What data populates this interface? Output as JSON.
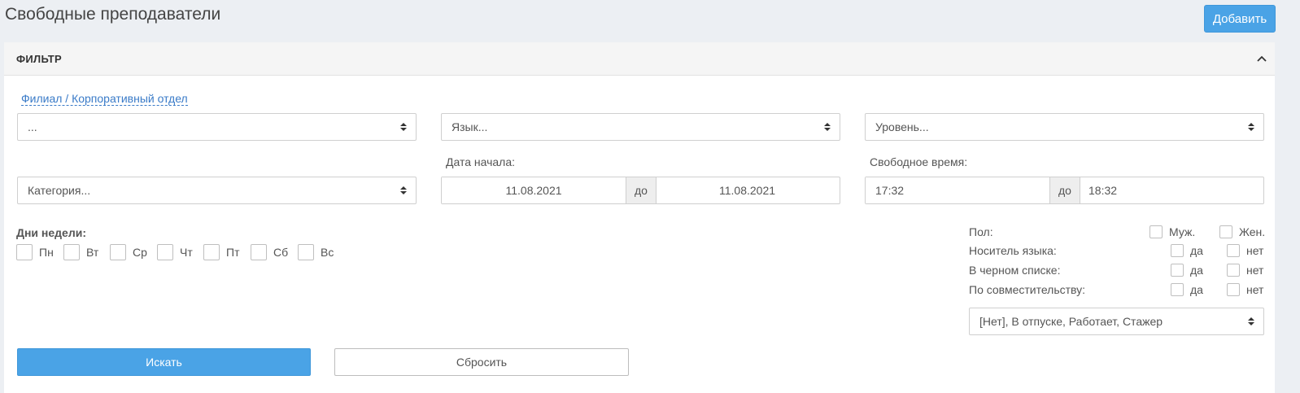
{
  "page": {
    "title": "Свободные преподаватели",
    "add_button": "Добавить"
  },
  "filter": {
    "title": "ФИЛЬТР",
    "branch_link": "Филиал / Корпоративный отдел",
    "branch_select": "...",
    "language_select": "Язык...",
    "level_select": "Уровень...",
    "category_select": "Категория...",
    "start_date": {
      "label": "Дата начала:",
      "from": "11.08.2021",
      "separator": "до",
      "to": "11.08.2021"
    },
    "free_time": {
      "label": "Свободное время:",
      "from": "17:32",
      "separator": "до",
      "to": "18:32"
    },
    "weekdays": {
      "label": "Дни недели:",
      "days": [
        "Пн",
        "Вт",
        "Ср",
        "Чт",
        "Пт",
        "Сб",
        "Вс"
      ]
    },
    "properties": {
      "gender": {
        "label": "Пол:",
        "opt1": "Муж.",
        "opt2": "Жен."
      },
      "native": {
        "label": "Носитель языка:",
        "opt1": "да",
        "opt2": "нет"
      },
      "blacklist": {
        "label": "В черном списке:",
        "opt1": "да",
        "opt2": "нет"
      },
      "parttime": {
        "label": "По совместительству:",
        "opt1": "да",
        "opt2": "нет"
      }
    },
    "status_select": "[Нет], В отпуске, Работает, Стажер",
    "search_button": "Искать",
    "reset_button": "Сбросить"
  },
  "colors": {
    "primary": "#4aa3e6",
    "link": "#3a7bc8",
    "background": "#eceff3"
  }
}
